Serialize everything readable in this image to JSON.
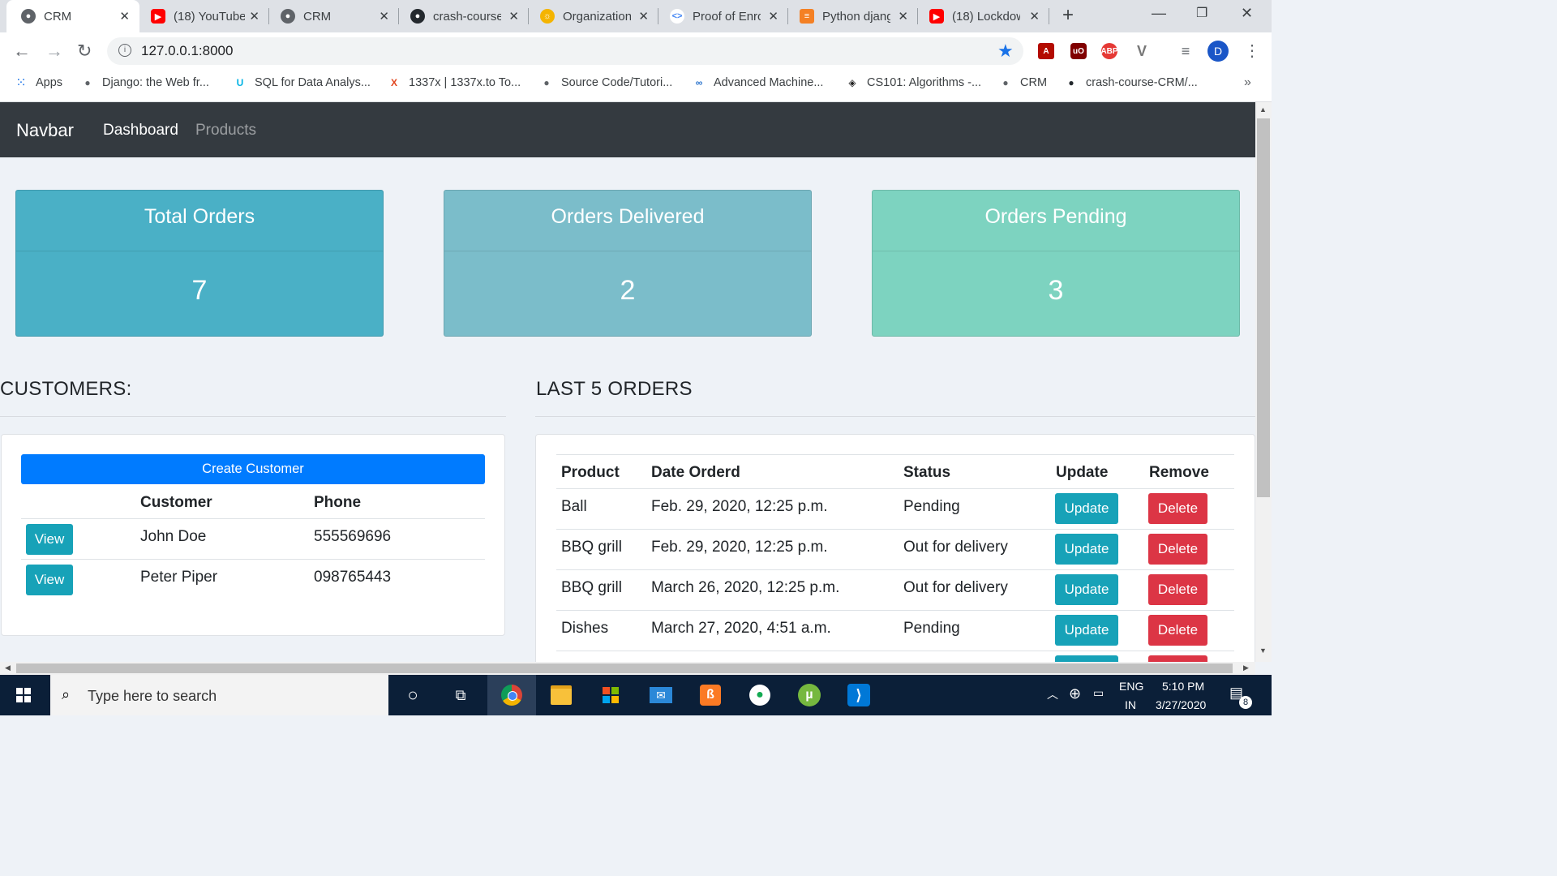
{
  "browser": {
    "tabs": [
      {
        "title": "CRM",
        "icon": "globe-icon",
        "color": "#5f6368"
      },
      {
        "title": "(18) YouTube",
        "icon": "youtube-icon",
        "color": "#ff0000"
      },
      {
        "title": "CRM",
        "icon": "globe-icon",
        "color": "#5f6368"
      },
      {
        "title": "crash-course",
        "icon": "github-icon",
        "color": "#24292e"
      },
      {
        "title": "Organization",
        "icon": "org-icon",
        "color": "#f4b400"
      },
      {
        "title": "Proof of Enro",
        "icon": "code-icon",
        "color": "#4285f4"
      },
      {
        "title": "Python djang",
        "icon": "stackoverflow-icon",
        "color": "#f48024"
      },
      {
        "title": "(18) Lockdow",
        "icon": "youtube-icon",
        "color": "#ff0000"
      }
    ],
    "url": "127.0.0.1:8000",
    "bookmarks": [
      {
        "label": "Apps",
        "icon": "apps-grid-icon"
      },
      {
        "label": "Django: the Web fr...",
        "icon": "globe-icon"
      },
      {
        "label": "SQL for Data Analys...",
        "icon": "udacity-icon"
      },
      {
        "label": "1337x | 1337x.to To...",
        "icon": "x-icon"
      },
      {
        "label": "Source Code/Tutori...",
        "icon": "globe-icon"
      },
      {
        "label": "Advanced Machine...",
        "icon": "coursera-icon"
      },
      {
        "label": "CS101: Algorithms -...",
        "icon": "diamond-icon"
      },
      {
        "label": "CRM",
        "icon": "globe-icon"
      },
      {
        "label": "crash-course-CRM/...",
        "icon": "github-icon"
      }
    ],
    "profile_initial": "D"
  },
  "navbar": {
    "brand": "Navbar",
    "links": [
      {
        "label": "Dashboard",
        "active": true
      },
      {
        "label": "Products",
        "active": false
      }
    ]
  },
  "stats": [
    {
      "title": "Total Orders",
      "value": "7",
      "color": "#4ab0c6"
    },
    {
      "title": "Orders Delivered",
      "value": "2",
      "color": "#7bbdca"
    },
    {
      "title": "Orders Pending",
      "value": "3",
      "color": "#7dd3c0"
    }
  ],
  "customers": {
    "heading": "CUSTOMERS:",
    "create_label": "Create Customer",
    "columns": [
      "Customer",
      "Phone"
    ],
    "rows": [
      {
        "action": "View",
        "name": "John Doe",
        "phone": "555569696"
      },
      {
        "action": "View",
        "name": "Peter Piper",
        "phone": "098765443"
      }
    ]
  },
  "orders": {
    "heading": "LAST 5 ORDERS",
    "columns": [
      "Product",
      "Date Orderd",
      "Status",
      "Update",
      "Remove"
    ],
    "rows": [
      {
        "product": "Ball",
        "date": "Feb. 29, 2020, 12:25 p.m.",
        "status": "Pending",
        "update": "Update",
        "remove": "Delete"
      },
      {
        "product": "BBQ grill",
        "date": "Feb. 29, 2020, 12:25 p.m.",
        "status": "Out for delivery",
        "update": "Update",
        "remove": "Delete"
      },
      {
        "product": "BBQ grill",
        "date": "March 26, 2020, 12:25 p.m.",
        "status": "Out for delivery",
        "update": "Update",
        "remove": "Delete"
      },
      {
        "product": "Dishes",
        "date": "March 27, 2020, 4:51 a.m.",
        "status": "Pending",
        "update": "Update",
        "remove": "Delete"
      }
    ]
  },
  "taskbar": {
    "search_placeholder": "Type here to search",
    "lang": "ENG",
    "region": "IN",
    "time": "5:10 PM",
    "date": "3/27/2020",
    "notifications": "8"
  }
}
